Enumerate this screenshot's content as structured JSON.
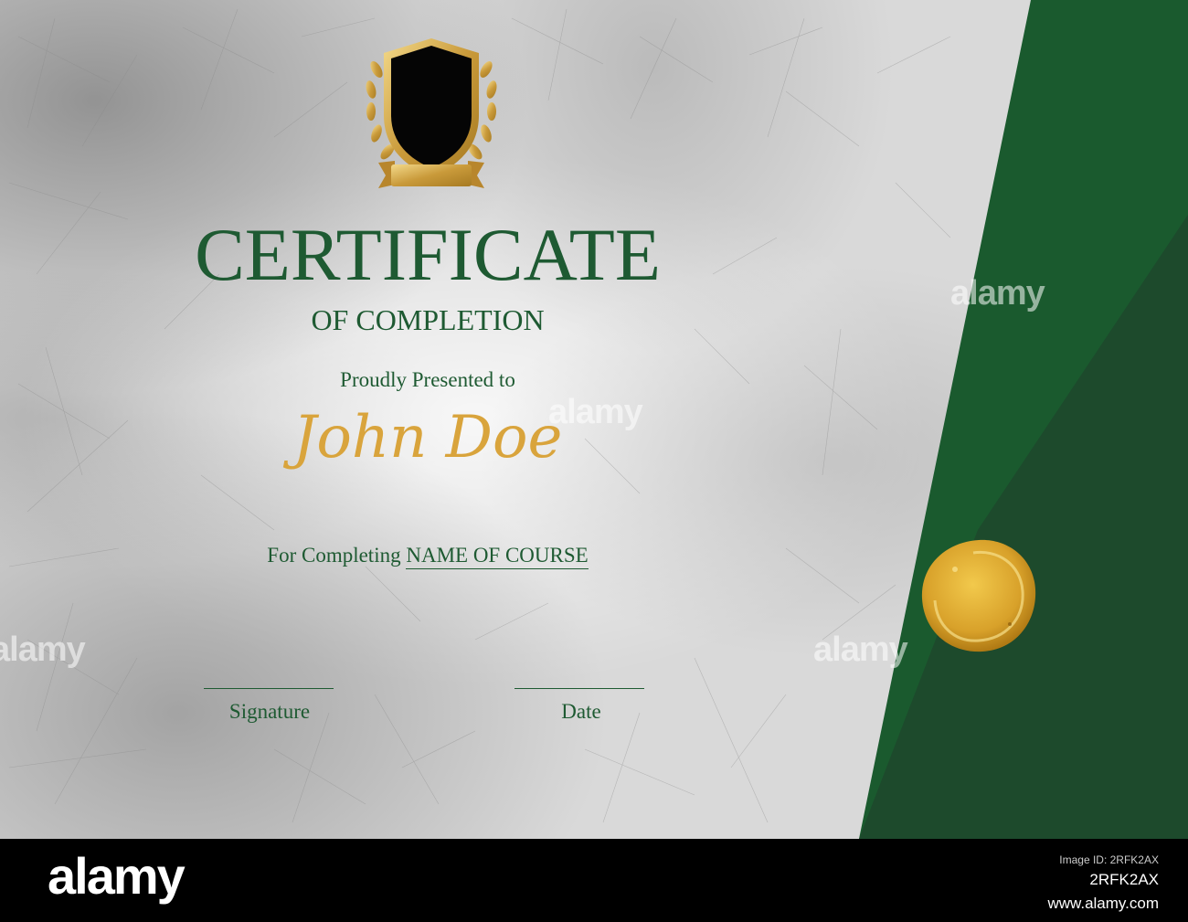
{
  "certificate": {
    "title": "CERTIFICATE",
    "subtitle": "OF COMPLETION",
    "presented_to": "Proudly Presented to",
    "recipient": "John Doe",
    "course_prefix": "For Completing",
    "course_name": "NAME OF COURSE",
    "signature_label": "Signature",
    "date_label": "Date"
  },
  "watermark": {
    "text": "alamy"
  },
  "footer": {
    "logo": "alamy",
    "caption": "Image ID: 2RFK2AX",
    "image_id": "2RFK2AX",
    "url": "www.alamy.com"
  },
  "colors": {
    "green": "#1e5a32",
    "dark_green": "#1d4a2c",
    "gold": "#d9a43c",
    "paper": "#d9d9d9"
  },
  "icons": {
    "crest": "shield-laurel-crest-icon",
    "seal": "gold-seal-icon"
  }
}
